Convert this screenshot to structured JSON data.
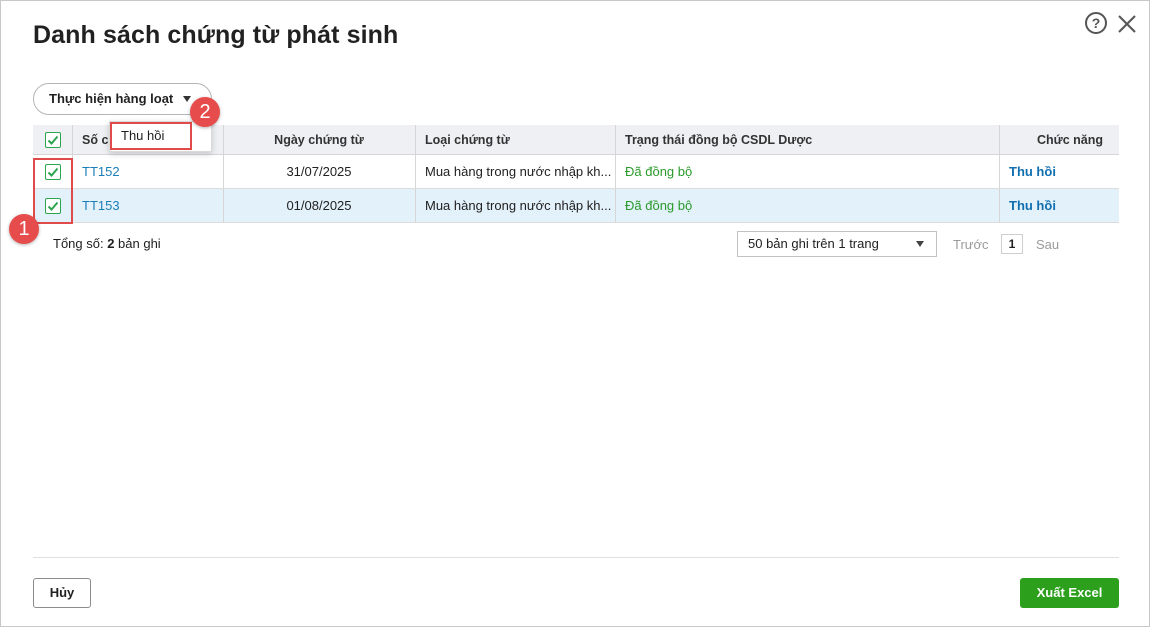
{
  "dialog": {
    "title": "Danh sách chứng từ phát sinh",
    "help_glyph": "?"
  },
  "toolbar": {
    "batch_label": "Thực hiện hàng loạt",
    "menu_items": [
      "Thu hồi"
    ]
  },
  "annotations": {
    "badge_1": "1",
    "badge_2": "2"
  },
  "table": {
    "columns": [
      "Số chứng từ",
      "Ngày chứng từ",
      "Loại chứng từ",
      "Trạng thái đồng bộ CSDL Dược",
      "Chức năng"
    ],
    "columns_visible_prefix": "Số c",
    "rows": [
      {
        "no": "TT152",
        "date": "31/07/2025",
        "type": "Mua hàng trong nước nhập kh...",
        "status": "Đã đồng bộ",
        "action": "Thu hồi"
      },
      {
        "no": "TT153",
        "date": "01/08/2025",
        "type": "Mua hàng trong nước nhập kh...",
        "status": "Đã đồng bộ",
        "action": "Thu hồi"
      }
    ]
  },
  "summary": {
    "total_prefix": "Tổng số: ",
    "total_count": "2",
    "total_suffix": " bản ghi"
  },
  "pager": {
    "page_size_label": "50 bản ghi trên 1 trang",
    "prev_label": "Trước",
    "current_page": "1",
    "next_label": "Sau"
  },
  "footer": {
    "cancel_label": "Hủy",
    "export_label": "Xuất Excel"
  },
  "colors": {
    "accent_green": "#2ca01c",
    "link_blue": "#1a7fb8",
    "status_green": "#2a9a2a",
    "annotation_red": "#e74c4c"
  }
}
